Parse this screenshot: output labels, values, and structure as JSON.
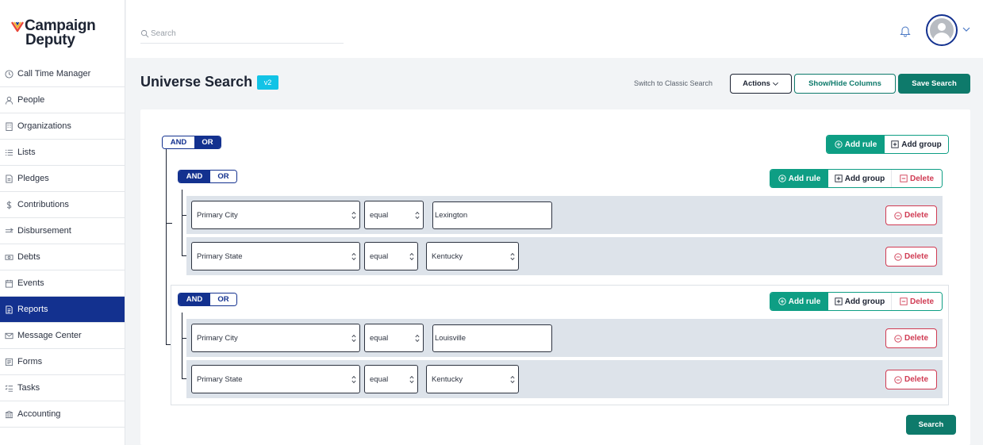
{
  "brand": {
    "line1": "Campaign",
    "line2": "Deputy"
  },
  "sidebar": {
    "items": [
      {
        "label": "Call Time Manager",
        "icon": "clock-icon"
      },
      {
        "label": "People",
        "icon": "person-icon"
      },
      {
        "label": "Organizations",
        "icon": "building-icon"
      },
      {
        "label": "Lists",
        "icon": "list-icon"
      },
      {
        "label": "Pledges",
        "icon": "pledge-icon"
      },
      {
        "label": "Contributions",
        "icon": "dollar-icon"
      },
      {
        "label": "Disbursement",
        "icon": "disbursement-icon"
      },
      {
        "label": "Debts",
        "icon": "debts-icon"
      },
      {
        "label": "Events",
        "icon": "calendar-icon"
      },
      {
        "label": "Reports",
        "icon": "report-icon",
        "active": true
      },
      {
        "label": "Message Center",
        "icon": "mail-icon"
      },
      {
        "label": "Forms",
        "icon": "forms-icon"
      },
      {
        "label": "Tasks",
        "icon": "tasks-icon"
      },
      {
        "label": "Accounting",
        "icon": "bank-icon"
      }
    ]
  },
  "topbar": {
    "search_placeholder": "Search"
  },
  "header": {
    "title": "Universe Search",
    "badge": "v2",
    "classic_link": "Switch to Classic Search",
    "actions_label": "Actions",
    "showhide_label": "Show/Hide Columns",
    "save_label": "Save Search"
  },
  "builder": {
    "and_label": "AND",
    "or_label": "OR",
    "add_rule_label": "Add rule",
    "add_group_label": "Add group",
    "delete_label": "Delete",
    "root": {
      "combinator": "OR"
    },
    "groups": [
      {
        "combinator": "AND",
        "rules": [
          {
            "field": "Primary City",
            "operator": "equal",
            "value": "Lexington",
            "value_type": "text"
          },
          {
            "field": "Primary State",
            "operator": "equal",
            "value": "Kentucky",
            "value_type": "select"
          }
        ]
      },
      {
        "combinator": "AND",
        "rules": [
          {
            "field": "Primary City",
            "operator": "equal",
            "value": "Louisville",
            "value_type": "text"
          },
          {
            "field": "Primary State",
            "operator": "equal",
            "value": "Kentucky",
            "value_type": "select"
          }
        ]
      }
    ],
    "search_label": "Search"
  },
  "colors": {
    "primary_navy": "#13318f",
    "teal": "#0e7a6b",
    "teal_light": "#0e9e84",
    "danger": "#d03b53",
    "badge_cyan": "#12c3e6",
    "row_bg": "#dde3ea"
  }
}
